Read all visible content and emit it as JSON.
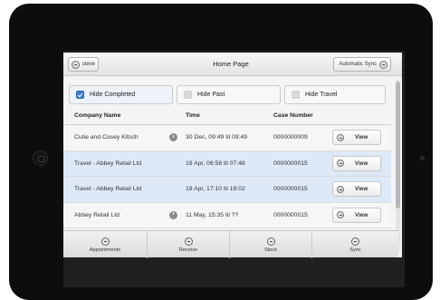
{
  "header": {
    "user_label": "steve",
    "title": "Home Page",
    "sync_label": "Automatic Sync"
  },
  "filters": [
    {
      "label": "Hide Completed",
      "checked": true
    },
    {
      "label": "Hide Past",
      "checked": false
    },
    {
      "label": "Hide Travel",
      "checked": false
    }
  ],
  "columns": [
    "Company Name",
    "Time",
    "Case Number"
  ],
  "rows": [
    {
      "company": "Cutie and Cosey Kitsch",
      "time": "30 Dec, 09:49 til 09:49",
      "case": "0000000009",
      "action": "View",
      "travel": false,
      "clock": true
    },
    {
      "company": "Travel - Abbey Retail Ltd",
      "time": "19 Apr, 06:58 til 07:48",
      "case": "0000000015",
      "action": "View",
      "travel": true,
      "clock": false
    },
    {
      "company": "Travel - Abbey Retail Ltd",
      "time": "19 Apr, 17:10 til 19:02",
      "case": "0000000015",
      "action": "View",
      "travel": true,
      "clock": false
    },
    {
      "company": "Abbey Retail Ltd",
      "time": "11 May, 15:35 til ??",
      "case": "0000000015",
      "action": "View",
      "travel": false,
      "clock": true
    }
  ],
  "nav": [
    {
      "label": "Appointments",
      "icon": "minus-circle-icon"
    },
    {
      "label": "Receive",
      "icon": "plus-circle-icon"
    },
    {
      "label": "Stock",
      "icon": "refresh-icon"
    },
    {
      "label": "Sync",
      "icon": "gear-icon"
    }
  ],
  "colors": {
    "accent": "#3d7fd4",
    "travel_row": "#dde9f7",
    "bezel": "#0d0d0d"
  }
}
